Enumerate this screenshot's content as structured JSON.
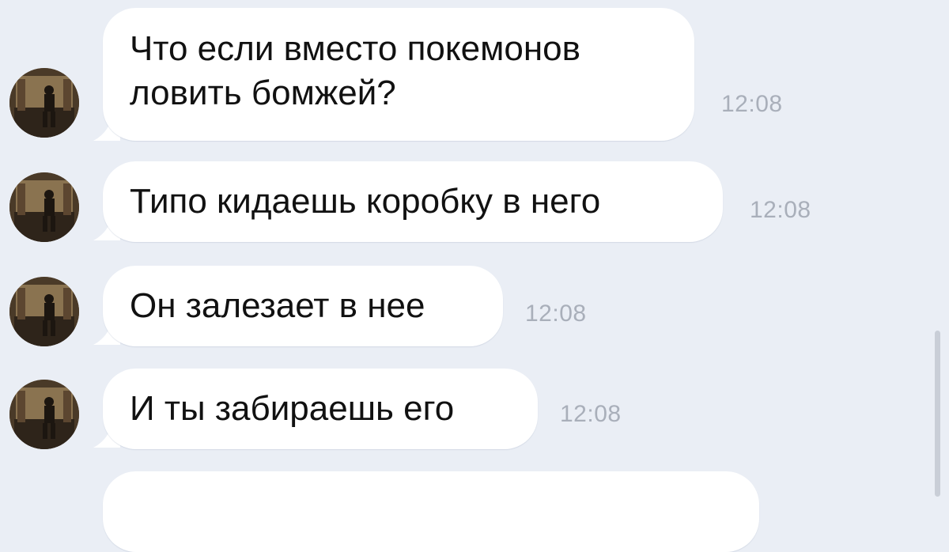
{
  "messages": [
    {
      "text": "Что если вместо покемонов ловить бомжей?",
      "time": "12:08"
    },
    {
      "text": "Типо кидаешь коробку в него",
      "time": "12:08"
    },
    {
      "text": "Он залезает в нее",
      "time": "12:08"
    },
    {
      "text": "И ты забираешь его",
      "time": "12:08"
    }
  ],
  "colors": {
    "background": "#eaeef5",
    "bubble": "#ffffff",
    "text": "#111111",
    "time": "#a9afba"
  }
}
